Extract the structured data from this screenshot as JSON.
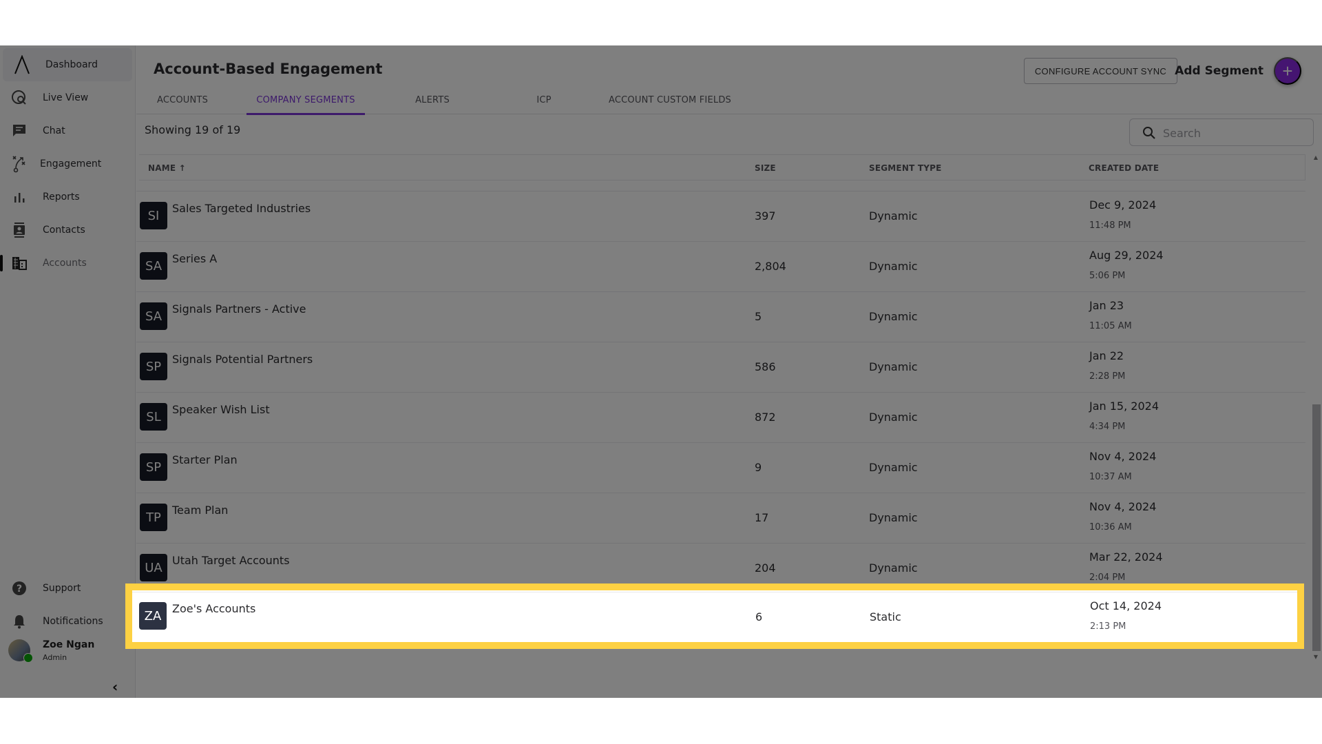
{
  "sidebar": {
    "items": [
      {
        "label": "Dashboard",
        "icon": "logo-icon"
      },
      {
        "label": "Live View",
        "icon": "live-view-icon"
      },
      {
        "label": "Chat",
        "icon": "chat-icon"
      },
      {
        "label": "Engagement",
        "icon": "engagement-icon"
      },
      {
        "label": "Reports",
        "icon": "bar-chart-icon"
      },
      {
        "label": "Contacts",
        "icon": "contacts-icon"
      },
      {
        "label": "Accounts",
        "icon": "building-icon"
      }
    ],
    "footer": {
      "support_label": "Support",
      "notifications_label": "Notifications",
      "user_name": "Zoe Ngan",
      "user_role": "Admin",
      "collapse_glyph": "‹"
    }
  },
  "header": {
    "title": "Account-Based Engagement",
    "configure_label": "CONFIGURE ACCOUNT SYNC",
    "add_segment_label": "Add Segment",
    "add_glyph": "+"
  },
  "tabs": [
    {
      "label": "ACCOUNTS",
      "active": false
    },
    {
      "label": "COMPANY SEGMENTS",
      "active": true
    },
    {
      "label": "ALERTS",
      "active": false
    },
    {
      "label": "ICP",
      "active": false
    },
    {
      "label": "ACCOUNT CUSTOM FIELDS",
      "active": false
    }
  ],
  "toolbar": {
    "showing_text": "Showing 19 of  19",
    "search_placeholder": "Search",
    "search_value": ""
  },
  "table": {
    "columns": [
      "NAME ↑",
      "SIZE",
      "SEGMENT TYPE",
      "CREATED DATE"
    ],
    "rows": [
      {
        "initials": "SI",
        "name": "Sales Targeted Industries",
        "size": "397",
        "type": "Dynamic",
        "date": "Dec 9, 2024",
        "time": "11:48 PM"
      },
      {
        "initials": "SA",
        "name": "Series A",
        "size": "2,804",
        "type": "Dynamic",
        "date": "Aug 29, 2024",
        "time": "5:06 PM"
      },
      {
        "initials": "SA",
        "name": "Signals Partners - Active",
        "size": "5",
        "type": "Dynamic",
        "date": "Jan 23",
        "time": "11:05 AM"
      },
      {
        "initials": "SP",
        "name": "Signals Potential Partners",
        "size": "586",
        "type": "Dynamic",
        "date": "Jan 22",
        "time": "2:28 PM"
      },
      {
        "initials": "SL",
        "name": "Speaker Wish List",
        "size": "872",
        "type": "Dynamic",
        "date": "Jan 15, 2024",
        "time": "4:34 PM"
      },
      {
        "initials": "SP",
        "name": "Starter Plan",
        "size": "9",
        "type": "Dynamic",
        "date": "Nov 4, 2024",
        "time": "10:37 AM"
      },
      {
        "initials": "TP",
        "name": "Team Plan",
        "size": "17",
        "type": "Dynamic",
        "date": "Nov 4, 2024",
        "time": "10:36 AM"
      },
      {
        "initials": "UA",
        "name": "Utah Target Accounts",
        "size": "204",
        "type": "Dynamic",
        "date": "Mar 22, 2024",
        "time": "2:04 PM"
      }
    ],
    "highlighted_row": {
      "initials": "ZA",
      "name": "Zoe's Accounts",
      "size": "6",
      "type": "Static",
      "date": "Oct 14, 2024",
      "time": "2:13 PM"
    }
  },
  "colors": {
    "accent": "#7b35d6",
    "add_button": "#8a2be2",
    "highlight_border": "#fdd143",
    "avatar_bg": "#171a26",
    "online_status": "#0aa60a"
  }
}
